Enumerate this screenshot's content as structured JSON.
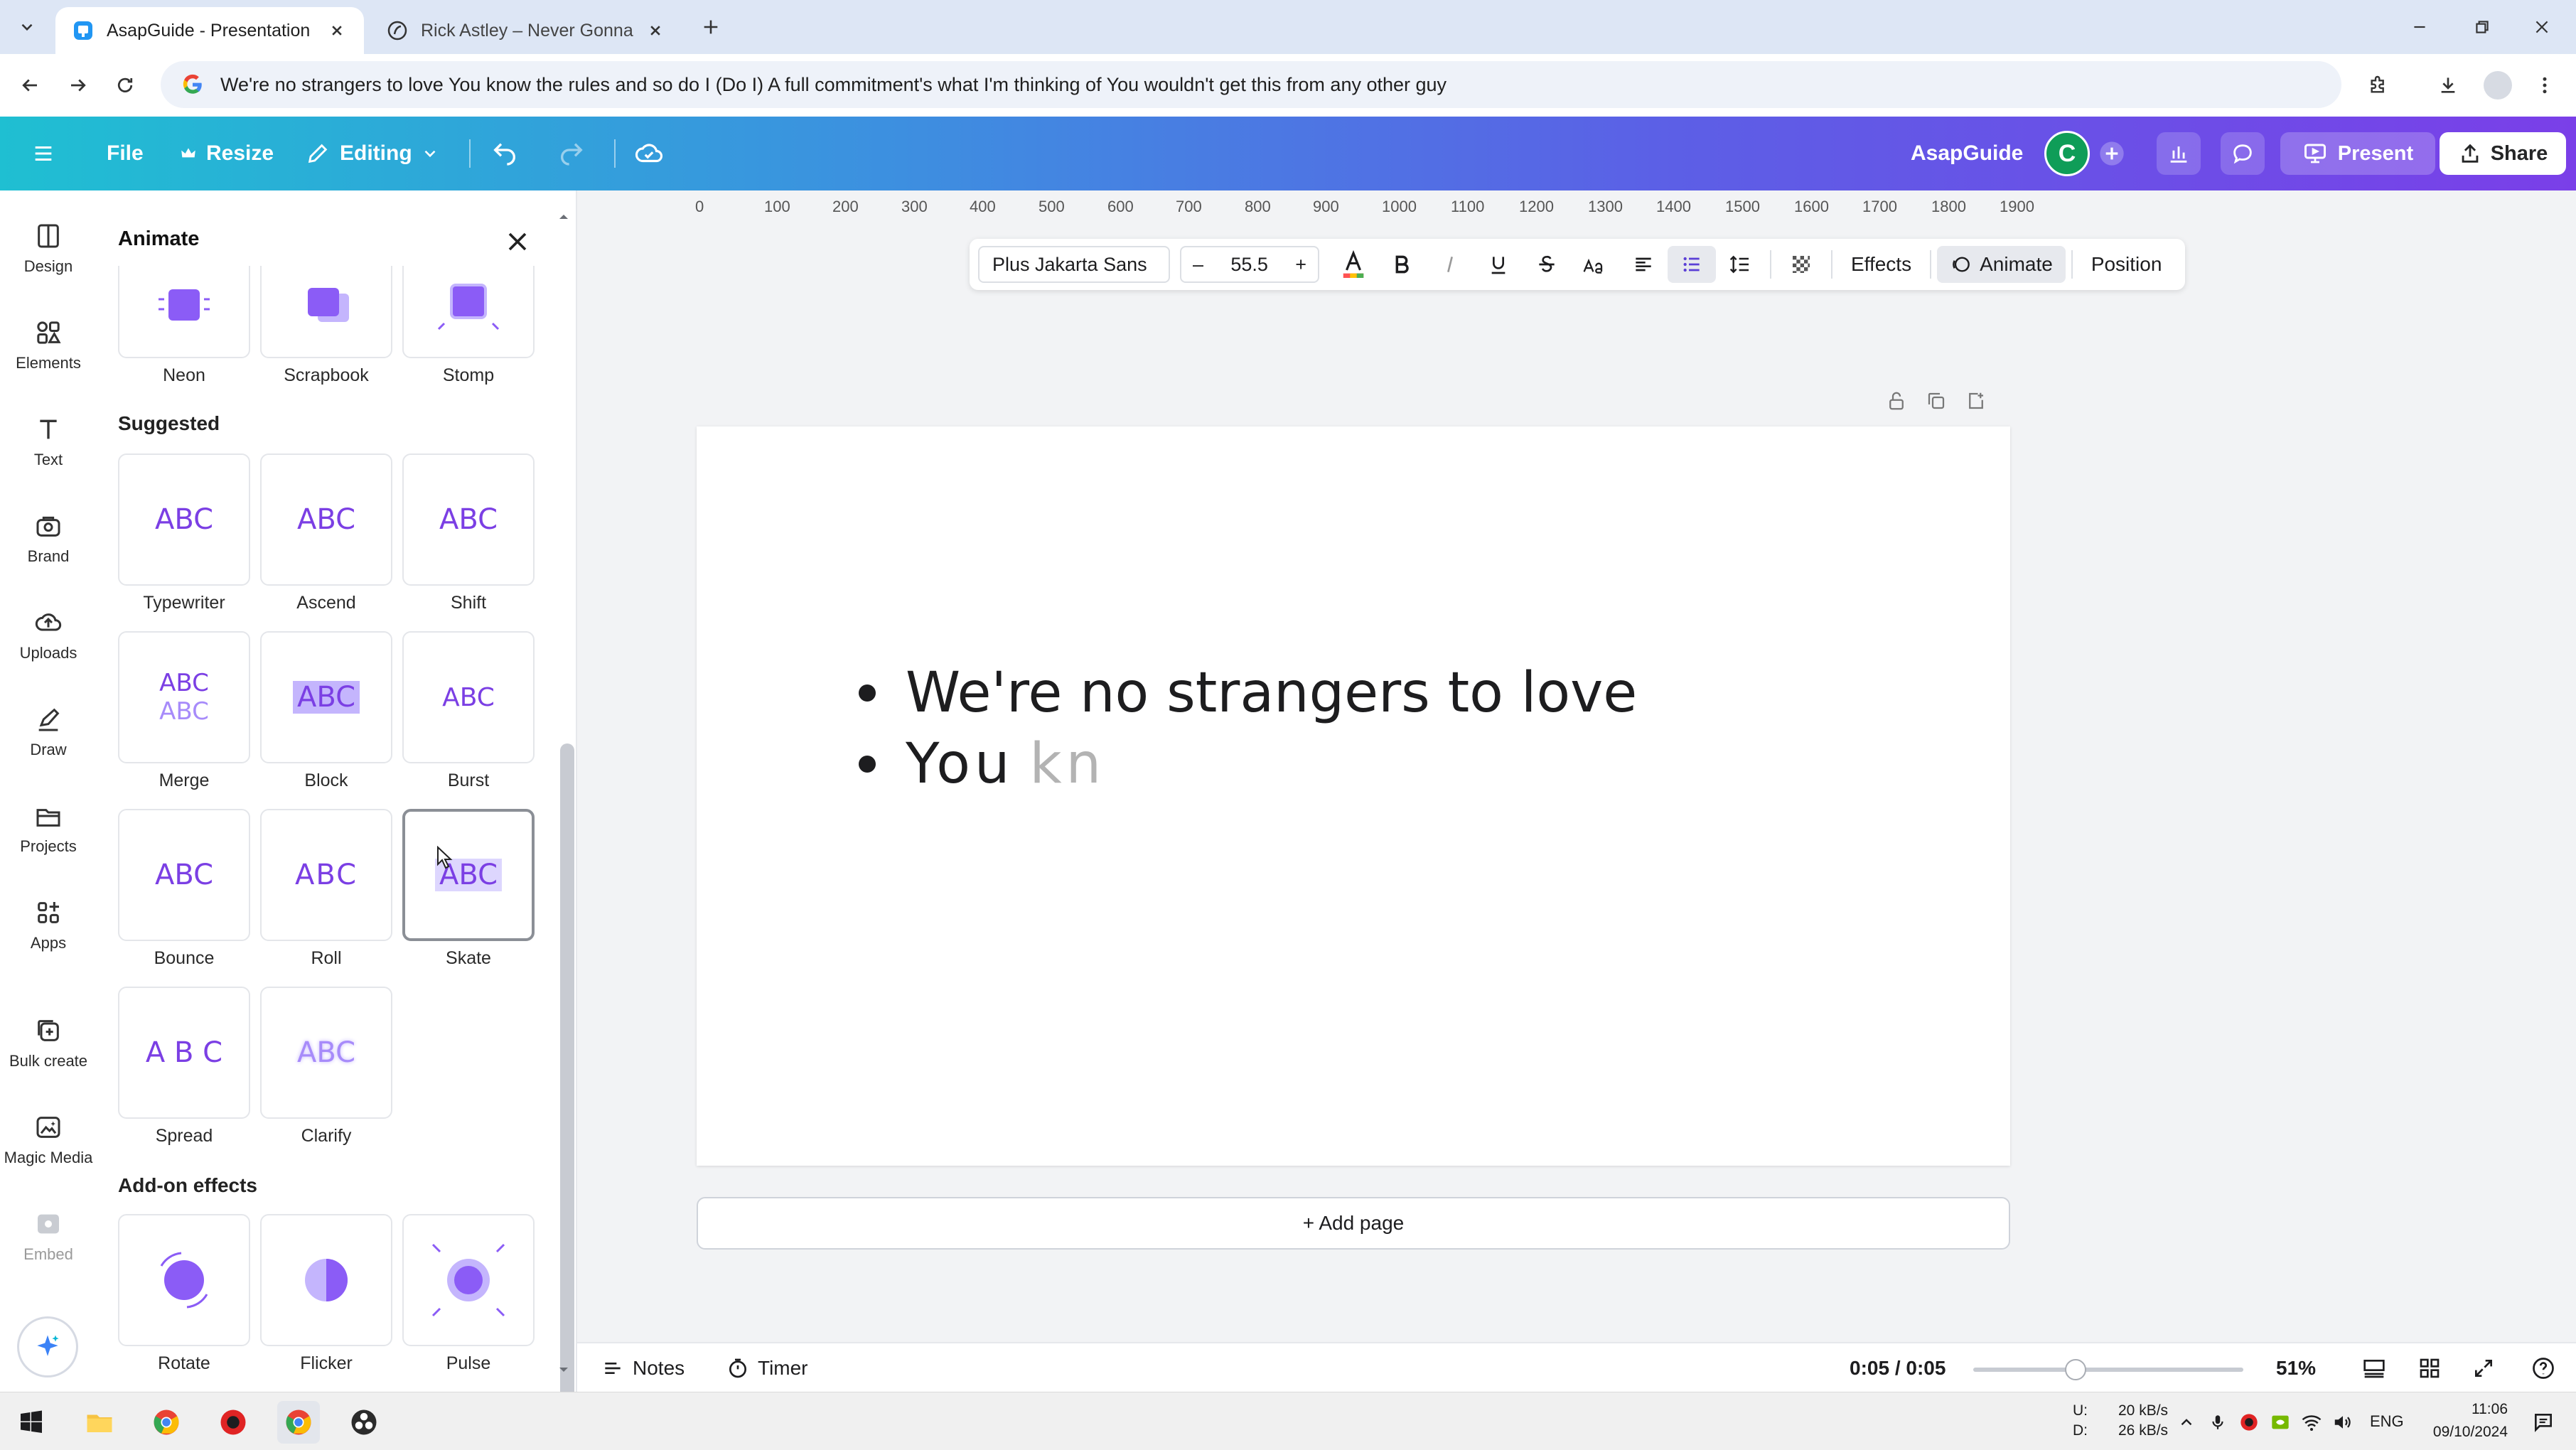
{
  "browser": {
    "tabs": [
      {
        "title": "AsapGuide - Presentation",
        "active": true
      },
      {
        "title": "Rick Astley – Never Gonna Give",
        "active": false
      }
    ],
    "address": "We're no strangers to love You know the rules and so do I (Do I) A full commitment's what I'm thinking of You wouldn't get this from any other guy"
  },
  "header": {
    "file": "File",
    "resize": "Resize",
    "editing": "Editing",
    "user_name": "AsapGuide",
    "avatar_letter": "C",
    "present": "Present",
    "share": "Share"
  },
  "rail": {
    "items": [
      {
        "label": "Design",
        "icon": "design-icon"
      },
      {
        "label": "Elements",
        "icon": "elements-icon"
      },
      {
        "label": "Text",
        "icon": "text-icon"
      },
      {
        "label": "Brand",
        "icon": "brand-icon"
      },
      {
        "label": "Uploads",
        "icon": "uploads-icon"
      },
      {
        "label": "Draw",
        "icon": "draw-icon"
      },
      {
        "label": "Projects",
        "icon": "projects-icon"
      },
      {
        "label": "Apps",
        "icon": "apps-icon"
      },
      {
        "label": "Bulk create",
        "icon": "bulk-create-icon"
      },
      {
        "label": "Magic Media",
        "icon": "magic-media-icon"
      },
      {
        "label": "Embed",
        "icon": "embed-icon"
      }
    ]
  },
  "panel": {
    "title": "Animate",
    "top_row": [
      "Neon",
      "Scrapbook",
      "Stomp"
    ],
    "suggested_label": "Suggested",
    "suggested": [
      {
        "label": "Typewriter",
        "glyph": "ABC"
      },
      {
        "label": "Ascend",
        "glyph": "ABC"
      },
      {
        "label": "Shift",
        "glyph": "ABC"
      },
      {
        "label": "Merge",
        "glyph": "ABC"
      },
      {
        "label": "Block",
        "glyph": "ABC"
      },
      {
        "label": "Burst",
        "glyph": "ABC"
      },
      {
        "label": "Bounce",
        "glyph": "ABC"
      },
      {
        "label": "Roll",
        "glyph": "ABC"
      },
      {
        "label": "Skate",
        "glyph": "ABC"
      },
      {
        "label": "Spread",
        "glyph": "A B C"
      },
      {
        "label": "Clarify",
        "glyph": "ABC"
      }
    ],
    "addon_label": "Add-on effects",
    "addons": [
      "Rotate",
      "Flicker",
      "Pulse"
    ],
    "accent_color": "#7b3fe4"
  },
  "toolbar": {
    "font": "Plus Jakarta Sans",
    "minus": "–",
    "size": "55.5",
    "plus": "+",
    "effects": "Effects",
    "animate": "Animate",
    "position": "Position"
  },
  "ruler": [
    "0",
    "100",
    "200",
    "300",
    "400",
    "500",
    "600",
    "700",
    "800",
    "900",
    "1000",
    "1100",
    "1200",
    "1300",
    "1400",
    "1500",
    "1600",
    "1700",
    "1800",
    "1900"
  ],
  "slide": {
    "line1": "We're no strangers to love",
    "line2": "You",
    "line2_partial": "kn"
  },
  "add_page": "+ Add page",
  "status": {
    "notes": "Notes",
    "timer": "Timer",
    "time": "0:05 / 0:05",
    "zoom": "51%",
    "progress_fraction": 0.38
  },
  "taskbar": {
    "net_up_label": "U:",
    "net_down_label": "D:",
    "net_up": "20 kB/s",
    "net_down": "26 kB/s",
    "lang": "ENG",
    "time": "11:06",
    "date": "09/10/2024"
  }
}
